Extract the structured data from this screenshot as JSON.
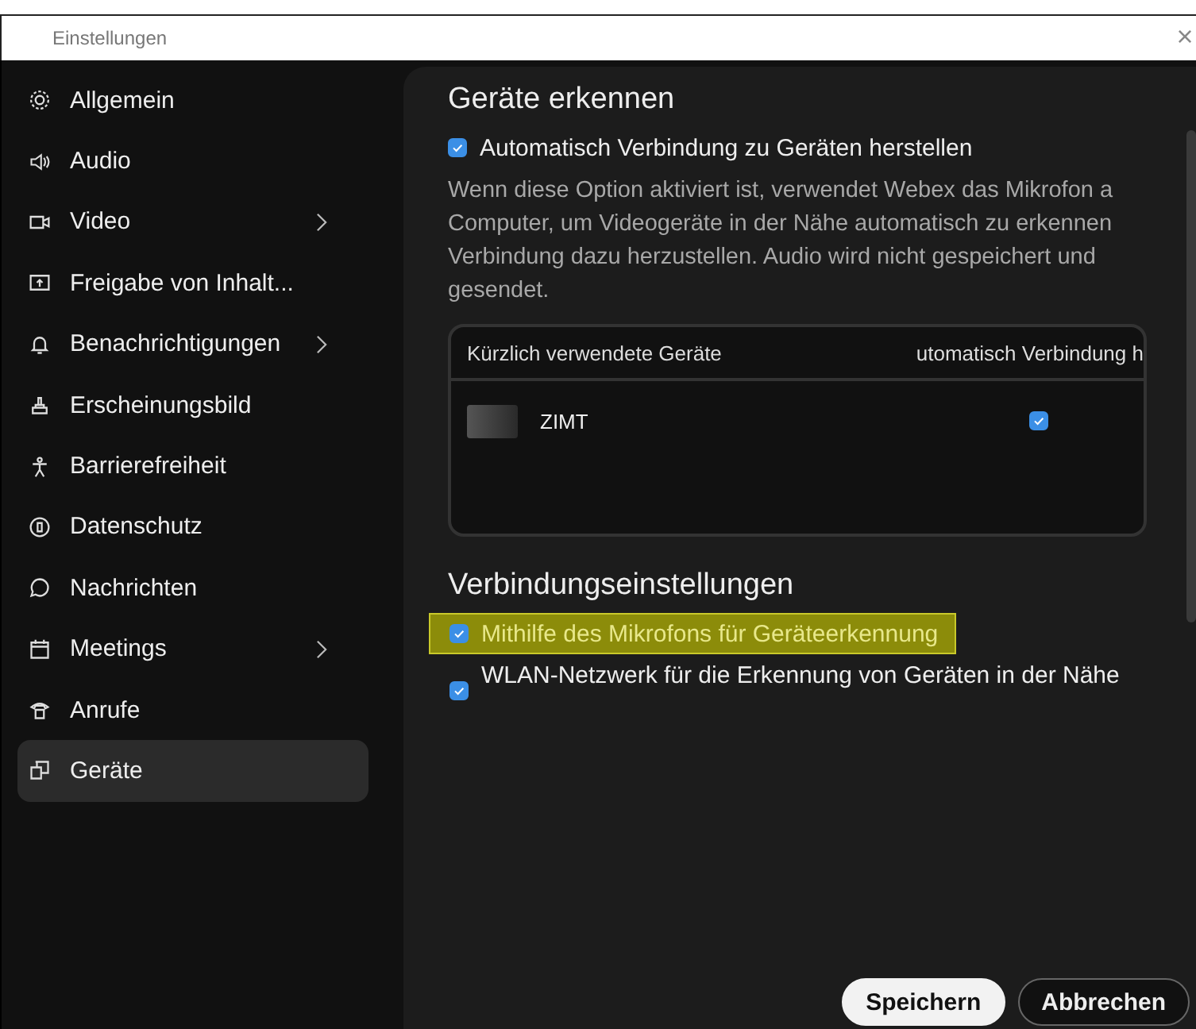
{
  "window": {
    "title": "Einstellungen",
    "close": "×"
  },
  "sidebar": {
    "items": [
      {
        "label": "Allgemein",
        "selected": false,
        "has_submenu": false
      },
      {
        "label": "Audio",
        "selected": false,
        "has_submenu": false
      },
      {
        "label": "Video",
        "selected": false,
        "has_submenu": true
      },
      {
        "label": "Freigabe von Inhalt...",
        "selected": false,
        "has_submenu": false
      },
      {
        "label": "Benachrichtigungen",
        "selected": false,
        "has_submenu": true
      },
      {
        "label": "Erscheinungsbild",
        "selected": false,
        "has_submenu": false
      },
      {
        "label": "Barrierefreiheit",
        "selected": false,
        "has_submenu": false
      },
      {
        "label": "Datenschutz",
        "selected": false,
        "has_submenu": false
      },
      {
        "label": "Nachrichten",
        "selected": false,
        "has_submenu": false
      },
      {
        "label": "Meetings",
        "selected": false,
        "has_submenu": true
      },
      {
        "label": "Anrufe",
        "selected": false,
        "has_submenu": false
      },
      {
        "label": "Geräte",
        "selected": true,
        "has_submenu": false
      }
    ]
  },
  "detect": {
    "heading": "Geräte erkennen",
    "option": {
      "label": "Automatisch Verbindung zu Geräten herstellen",
      "checked": true
    },
    "description_lines": [
      "Wenn diese Option aktiviert ist, verwendet Webex das Mikrofon a",
      "Computer, um Videogeräte in der Nähe automatisch zu erkennen",
      "Verbindung dazu herzustellen. Audio wird nicht gespeichert und",
      "gesendet."
    ],
    "table": {
      "columns": [
        "Kürzlich verwendete Geräte",
        "utomatisch Verbindung h"
      ],
      "rows": [
        {
          "name": "ZIMT",
          "auto_connect": true
        }
      ]
    }
  },
  "connection": {
    "heading": "Verbindungseinstellungen",
    "options": [
      {
        "label": "Mithilfe des Mikrofons für Geräteerkennung",
        "checked": true,
        "highlighted": true
      },
      {
        "label": "WLAN-Netzwerk für die Erkennung von Geräten in der Nähe",
        "checked": true,
        "highlighted": false
      }
    ]
  },
  "buttons": [
    {
      "label": "Speichern",
      "kind": "primary"
    },
    {
      "label": "Abbrechen",
      "kind": "secondary"
    }
  ]
}
